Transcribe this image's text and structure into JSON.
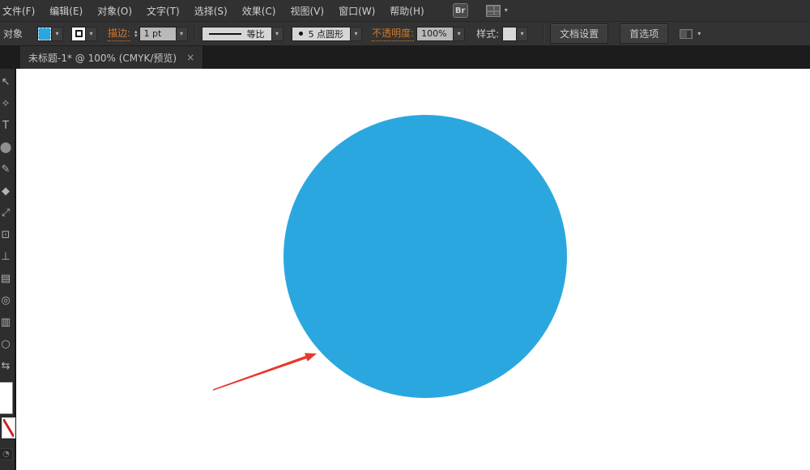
{
  "menu": {
    "items": [
      "文件(F)",
      "编辑(E)",
      "对象(O)",
      "文字(T)",
      "选择(S)",
      "效果(C)",
      "视图(V)",
      "窗口(W)",
      "帮助(H)"
    ],
    "bridge_label": "Br"
  },
  "control_bar": {
    "context_label": "对象",
    "stroke_label": "描边:",
    "stroke_width": "1 pt",
    "profile_value": "等比",
    "brush_value": "5 点圆形",
    "opacity_label": "不透明度:",
    "opacity_value": "100%",
    "style_label": "样式:",
    "document_setup_label": "文档设置",
    "preferences_label": "首选项"
  },
  "tab_bar": {
    "active_tab_title": "未标题-1* @ 100% (CMYK/预览)",
    "close_glyph": "×"
  },
  "toolbar": {
    "tools": [
      {
        "name": "selection-tool",
        "glyph": "↖"
      },
      {
        "name": "magic-wand-tool",
        "glyph": "✧"
      },
      {
        "name": "type-tool",
        "glyph": "T"
      },
      {
        "name": "ellipse-tool",
        "glyph": "⬤"
      },
      {
        "name": "pencil-tool",
        "glyph": "✎"
      },
      {
        "name": "eraser-tool",
        "glyph": "◆"
      },
      {
        "name": "scale-tool",
        "glyph": "⤢"
      },
      {
        "name": "artboard-tool",
        "glyph": "⊡"
      },
      {
        "name": "width-tool",
        "glyph": "⊥"
      },
      {
        "name": "blend-tool",
        "glyph": "▤"
      },
      {
        "name": "shape-builder-tool",
        "glyph": "◎"
      },
      {
        "name": "graph-tool",
        "glyph": "▥"
      },
      {
        "name": "zoom-tool",
        "glyph": "○"
      },
      {
        "name": "hand-tool",
        "glyph": "⇆"
      }
    ],
    "gradient_button_glyph": "◔"
  },
  "canvas": {
    "circle_color": "#2ba7df",
    "arrow_color": "#e8382d"
  },
  "icons": {
    "caret": "▾",
    "step_up": "▴",
    "step_down": "▾"
  },
  "colors": {
    "fill_swatch_blue": "#2ba7df",
    "accent_label_orange": "#cf7a2e",
    "menubar_bg": "#313131",
    "canvas_bg": "#ffffff"
  }
}
